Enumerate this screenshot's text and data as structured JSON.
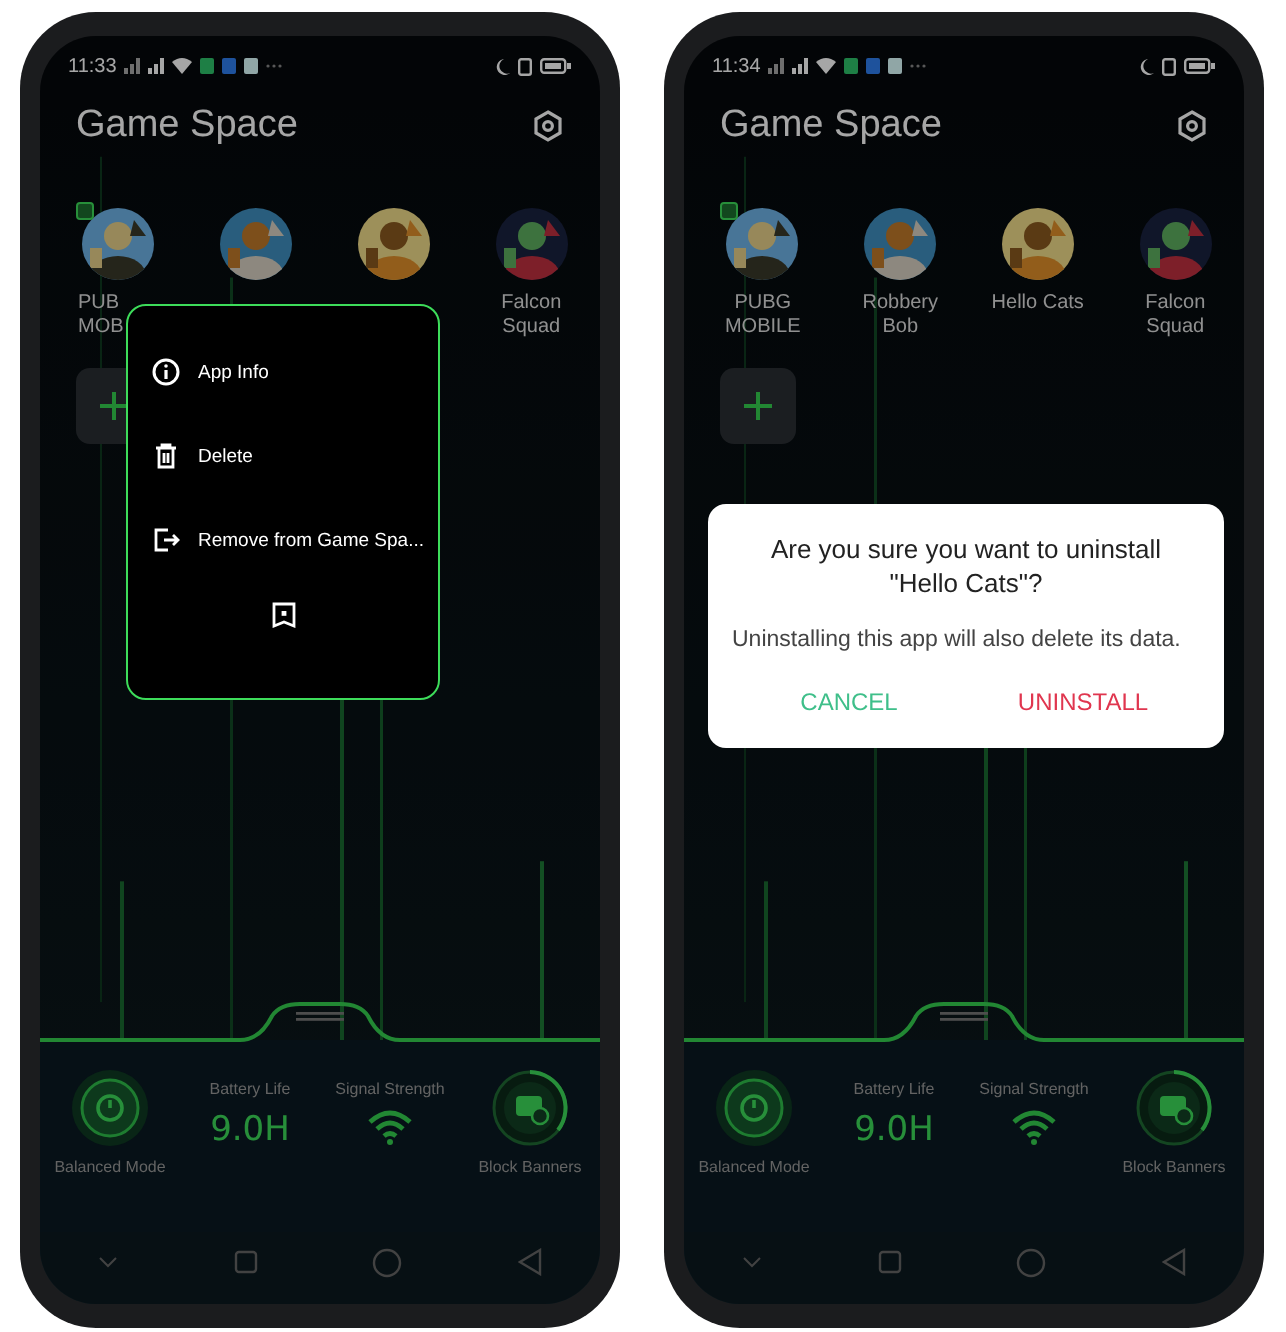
{
  "phones": [
    {
      "time": "11:33",
      "title": "Game Space",
      "games": [
        {
          "label_lines": [
            "PUB",
            "MOB"
          ],
          "cut": true,
          "badge": true
        },
        {
          "badge": false
        },
        {
          "badge": false
        },
        {
          "label_lines": [
            "Falcon",
            "Squad"
          ],
          "badge": false
        }
      ],
      "menu": {
        "items": [
          {
            "kind": "info",
            "label": "App Info"
          },
          {
            "kind": "delete",
            "label": "Delete"
          },
          {
            "kind": "remove",
            "label": "Remove from Game Spa..."
          }
        ]
      },
      "stats": {
        "mode": "Balanced Mode",
        "battery_label": "Battery Life",
        "battery_value": "9.0H",
        "signal_label": "Signal Strength",
        "banners": "Block Banners"
      }
    },
    {
      "time": "11:34",
      "title": "Game Space",
      "games": [
        {
          "label_lines": [
            "PUBG",
            "MOBILE"
          ],
          "badge": true
        },
        {
          "label_lines": [
            "Robbery",
            "Bob"
          ],
          "badge": false
        },
        {
          "label_lines": [
            "Hello Cats"
          ],
          "badge": false
        },
        {
          "label_lines": [
            "Falcon",
            "Squad"
          ],
          "badge": false
        }
      ],
      "dialog": {
        "title_lines": [
          "Are you sure you want to uninstall",
          "\"Hello Cats\"?"
        ],
        "body": "Uninstalling this app will also delete its data.",
        "buttons": [
          {
            "kind": "cancel",
            "label": "CANCEL"
          },
          {
            "kind": "confirm",
            "label": "UNINSTALL"
          }
        ]
      },
      "stats": {
        "mode": "Balanced Mode",
        "battery_label": "Battery Life",
        "battery_value": "9.0H",
        "signal_label": "Signal Strength",
        "banners": "Block Banners"
      }
    }
  ]
}
